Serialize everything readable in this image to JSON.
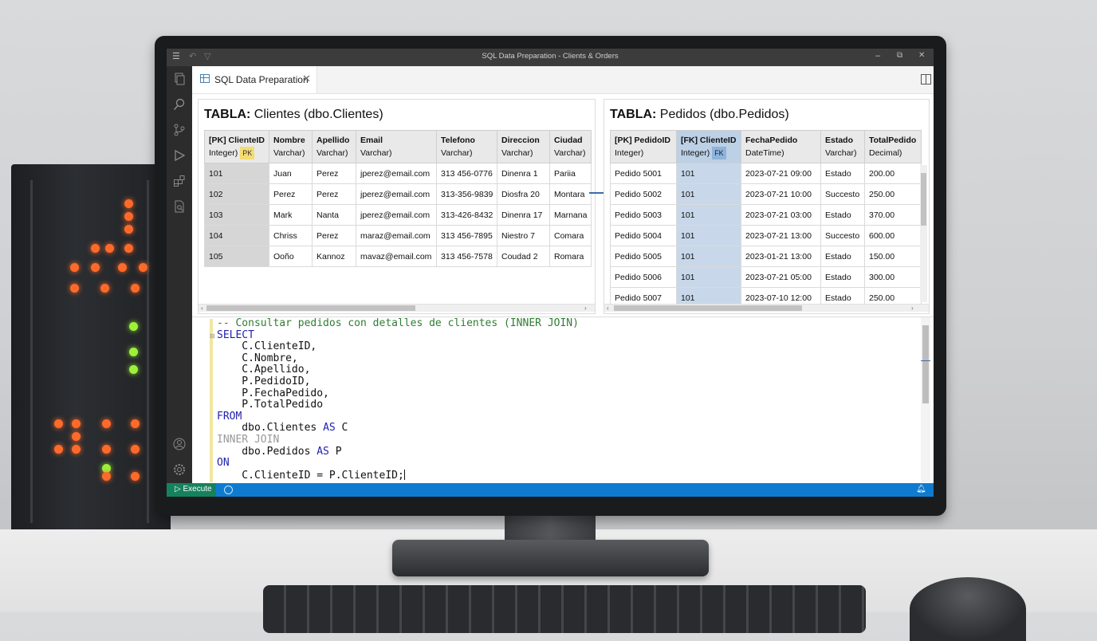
{
  "window": {
    "title": "SQL Data Preparation - Clients & Orders",
    "controls": {
      "minimize": "–",
      "maximize": "⧉",
      "close": "✕"
    }
  },
  "activity_bar": {
    "icons": [
      "menu-icon",
      "files-icon",
      "search-icon",
      "source-control-icon",
      "run-debug-icon",
      "extensions-icon",
      "report-icon",
      "account-icon",
      "settings-gear-icon"
    ]
  },
  "tab": {
    "label": "SQL Data Preparation",
    "close": "✕"
  },
  "clientes": {
    "title_bold": "TABLA:",
    "title_rest": " Clientes (dbo.Clientes)",
    "columns": [
      {
        "name": "[PK] ClienteID",
        "type": "Integer)",
        "badge": "PK"
      },
      {
        "name": "Nombre",
        "type": "Varchar)"
      },
      {
        "name": "Apellido",
        "type": "Varchar)"
      },
      {
        "name": "Email",
        "type": "Varchar)"
      },
      {
        "name": "Telefono",
        "type": "Varchar)"
      },
      {
        "name": "Direccion",
        "type": "Varchar)"
      },
      {
        "name": "Ciudad",
        "type": "Varchar)"
      }
    ],
    "rows": [
      [
        "101",
        "Juan",
        "Perez",
        "jperez@email.com",
        "313 456-0776",
        "Dinenra 1",
        "Pariia"
      ],
      [
        "102",
        "Perez",
        "Perez",
        "jperez@email.com",
        "313-356-9839",
        "Diosfra 20",
        "Montara"
      ],
      [
        "103",
        "Mark",
        "Nanta",
        "jperez@email.com",
        "313-426-8432",
        "Dinenra 17",
        "Marnana"
      ],
      [
        "104",
        "Chriss",
        "Perez",
        "maraz@email.com",
        "313 456-7895",
        "Niestro 7",
        "Comara"
      ],
      [
        "105",
        "Ooño",
        "Kannoz",
        "mavaz@email.com",
        "313 456-7578",
        "Coudad 2",
        "Romara"
      ]
    ]
  },
  "pedidos": {
    "title_bold": "TABLA:",
    "title_rest": " Pedidos (dbo.Pedidos)",
    "columns": [
      {
        "name": "[PK] PedidoID",
        "type": "Integer)"
      },
      {
        "name": "[FK] ClienteID",
        "type": "Integer)",
        "badge": "FK"
      },
      {
        "name": "FechaPedido",
        "type": "DateTime)"
      },
      {
        "name": "Estado",
        "type": "Varchar)"
      },
      {
        "name": "TotalPedido",
        "type": "Decimal)"
      }
    ],
    "rows": [
      [
        "Pedido 5001",
        "101",
        "2023-07-21 09:00",
        "Estado",
        "200.00"
      ],
      [
        "Pedido 5002",
        "101",
        "2023-07-21 10:00",
        "Succesto",
        "250.00"
      ],
      [
        "Pedido 5003",
        "101",
        "2023-07-21 03:00",
        "Estado",
        "370.00"
      ],
      [
        "Pedido 5004",
        "101",
        "2023-07-21 13:00",
        "Succesto",
        "600.00"
      ],
      [
        "Pedido 5005",
        "101",
        "2023-01-21 13:00",
        "Estado",
        "150.00"
      ],
      [
        "Pedido 5006",
        "101",
        "2023-07-21 05:00",
        "Estado",
        "300.00"
      ],
      [
        "Pedido 5007",
        "101",
        "2023-07-10 12:00",
        "Estado",
        "250.00"
      ]
    ]
  },
  "editor": {
    "lines": [
      [
        {
          "c": "cm",
          "t": "-- Consultar pedidos con detalles de clientes (INNER JOIN)"
        }
      ],
      [
        {
          "c": "kw",
          "t": "SELECT"
        }
      ],
      [
        {
          "c": "",
          "t": "    C.ClienteID,"
        }
      ],
      [
        {
          "c": "",
          "t": "    C.Nombre,"
        }
      ],
      [
        {
          "c": "",
          "t": "    C.Apellido,"
        }
      ],
      [
        {
          "c": "",
          "t": "    P.PedidoID,"
        }
      ],
      [
        {
          "c": "",
          "t": "    P.FechaPedido,"
        }
      ],
      [
        {
          "c": "",
          "t": "    P.TotalPedido"
        }
      ],
      [
        {
          "c": "kw",
          "t": "FROM"
        }
      ],
      [
        {
          "c": "",
          "t": "    dbo.Clientes "
        },
        {
          "c": "kw",
          "t": "AS"
        },
        {
          "c": "",
          "t": " C"
        }
      ],
      [
        {
          "c": "kg",
          "t": "INNER JOIN"
        }
      ],
      [
        {
          "c": "",
          "t": "    dbo.Pedidos "
        },
        {
          "c": "kw",
          "t": "AS"
        },
        {
          "c": "",
          "t": " P"
        }
      ],
      [
        {
          "c": "kw",
          "t": "ON"
        }
      ],
      [
        {
          "c": "",
          "t": "    C.ClienteID = P.ClienteID;"
        }
      ]
    ]
  },
  "statusbar": {
    "execute_label": "Execute",
    "execute_icon": "play-icon",
    "bell_icon": "bell-icon"
  },
  "colors": {
    "accent": "#0f7bd0",
    "execute": "#16825d",
    "pk_badge": "#f3dc73",
    "fk_column": "#c8d8ea"
  }
}
